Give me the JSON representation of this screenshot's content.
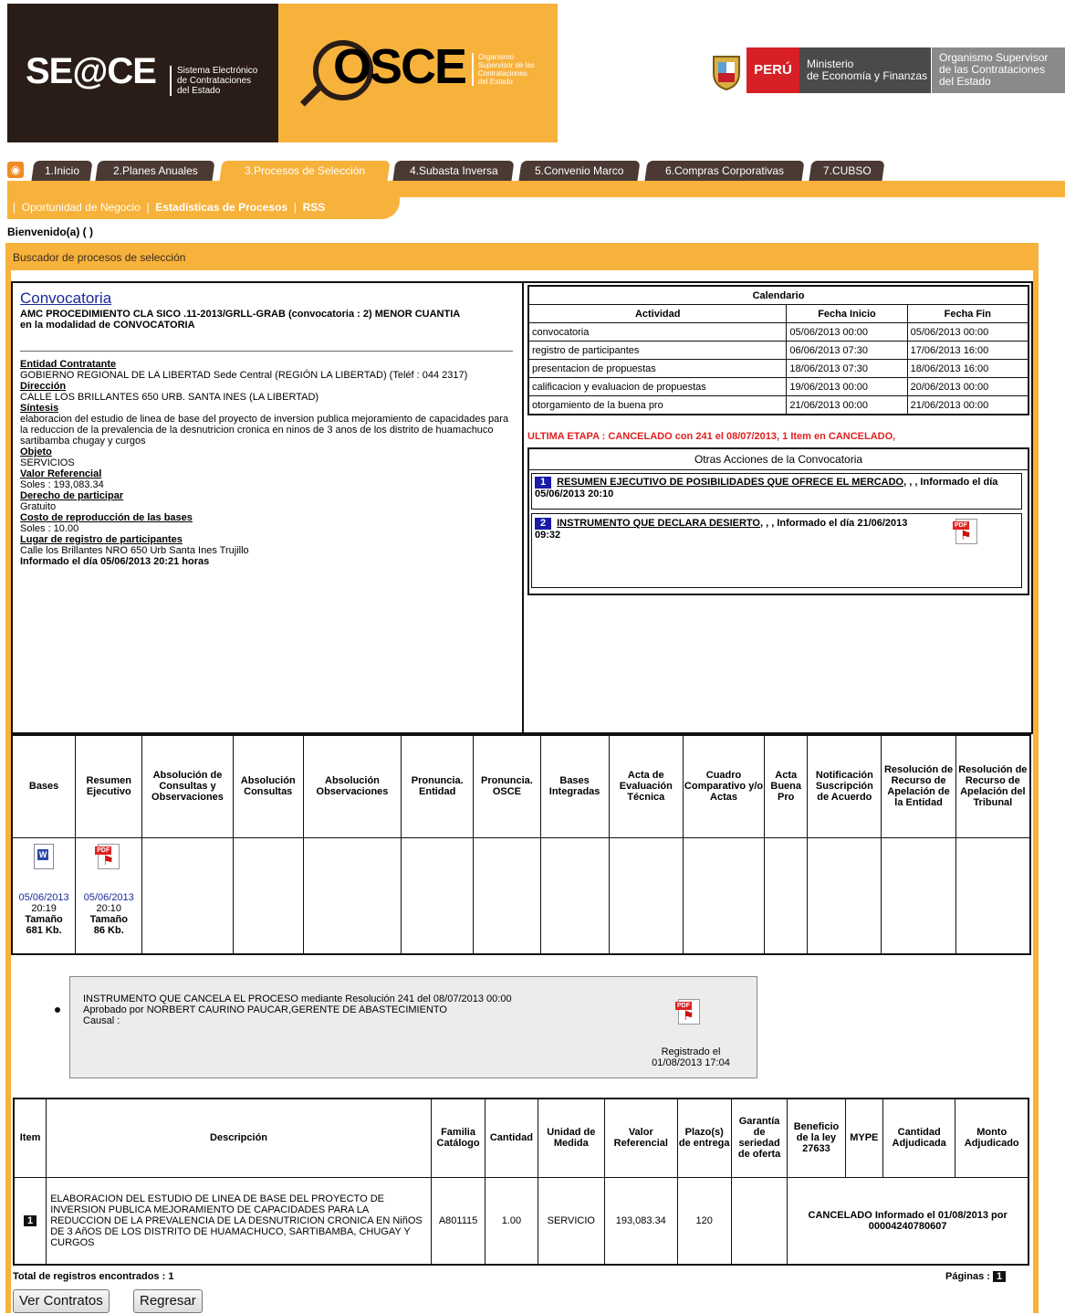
{
  "header": {
    "seace_logo": "SE@CE",
    "seace_sub": [
      "Sistema Electrónico",
      "de Contrataciones",
      "del Estado"
    ],
    "osce_logo": "OSCE",
    "osce_sub": [
      "Organismo",
      "Supervisor de las",
      "Contrataciones",
      "del Estado"
    ],
    "peru_label": "PERÚ",
    "ministerio": [
      "Ministerio",
      "de Economía y Finanzas"
    ],
    "osce_full": [
      "Organismo Supervisor",
      "de las Contrataciones",
      "del Estado"
    ]
  },
  "tabs": [
    {
      "label": "1.Inicio"
    },
    {
      "label": "2.Planes Anuales"
    },
    {
      "label": "3.Procesos de Selección"
    },
    {
      "label": "4.Subasta Inversa"
    },
    {
      "label": "5.Convenio Marco"
    },
    {
      "label": "6.Compras Corporativas"
    },
    {
      "label": "7.CUBSO"
    }
  ],
  "subnav": {
    "item1": "Oportunidad de Negocio",
    "item2": "Estadísticas de Procesos",
    "item3": "RSS",
    "sep": "|"
  },
  "welcome": "Bienvenido(a) ( )",
  "panel_title": "Buscador de procesos de selección",
  "convocatoria": {
    "title": "Convocatoria",
    "line1": "AMC PROCEDIMIENTO CLA SICO .11-2013/GRLL-GRAB (convocatoria : 2) MENOR CUANTIA",
    "line2": "en la modalidad de CONVOCATORIA",
    "entidad_label": "Entidad Contratante",
    "entidad": "GOBIERNO REGIONAL DE LA LIBERTAD Sede Central (REGIÓN LA LIBERTAD) (Teléf : 044 2317)",
    "direccion_label": "Dirección",
    "direccion": "CALLE LOS BRILLANTES 650 URB. SANTA INES (LA LIBERTAD)",
    "sintesis_label": "Síntesis",
    "sintesis": "elaboracion del estudio de linea de base del proyecto de inversion publica mejoramiento de capacidades para la reduccion de la prevalencia de la desnutricion cronica en ninos de 3 anos de los distrito de huamachuco sartibamba chugay y curgos",
    "objeto_label": "Objeto",
    "objeto": "SERVICIOS",
    "valor_label": "Valor Referencial",
    "valor": "Soles : 193,083.34",
    "derecho_label": "Derecho de participar",
    "derecho": "Gratuito",
    "costo_label": "Costo de reproducción de las bases",
    "costo": "Soles : 10.00",
    "lugar_label": "Lugar de registro de participantes",
    "lugar": "Calle los Brillantes NRO 650 Urb Santa Ines Trujillo",
    "informado": "Informado el día 05/06/2013 20:21 horas"
  },
  "calendario": {
    "title": "Calendario",
    "headers": [
      "Actividad",
      "Fecha Inicio",
      "Fecha Fin"
    ],
    "rows": [
      [
        "convocatoria",
        "05/06/2013 00:00",
        "05/06/2013 00:00"
      ],
      [
        "registro de participantes",
        "06/06/2013 07:30",
        "17/06/2013 16:00"
      ],
      [
        "presentacion de propuestas",
        "18/06/2013 07:30",
        "18/06/2013 16:00"
      ],
      [
        "calificacion y evaluacion de propuestas",
        "19/06/2013 00:00",
        "20/06/2013 00:00"
      ],
      [
        "otorgamiento de la buena pro",
        "21/06/2013 00:00",
        "21/06/2013 00:00"
      ]
    ],
    "ultima_etapa": "ULTIMA ETAPA : CANCELADO con 241 el 08/07/2013, 1 Item en CANCELADO,"
  },
  "otras": {
    "title": "Otras Acciones de la Convocatoria",
    "items": [
      {
        "num": "1",
        "title": "RESUMEN EJECUTIVO DE POSIBILIDADES QUE OFRECE EL MERCADO",
        "rest": ", , , Informado el día 05/06/2013 20:10"
      },
      {
        "num": "2",
        "title": "INSTRUMENTO QUE DECLARA DESIERTO",
        "rest": ", , , Informado el día 21/06/2013 09:32"
      }
    ]
  },
  "docs_table": {
    "headers": [
      "Bases",
      "Resumen Ejecutivo",
      "Absolución de Consultas y Observaciones",
      "Absolución Consultas",
      "Absolución Observaciones",
      "Pronuncia. Entidad",
      "Pronuncia. OSCE",
      "Bases Integradas",
      "Acta de Evaluación Técnica",
      "Cuadro Comparativo y/o Actas",
      "Acta Buena Pro",
      "Notificación Suscripción de Acuerdo",
      "Resolución de Recurso de Apelación de la Entidad",
      "Resolución de Recurso de Apelación del Tribunal"
    ],
    "bases": {
      "date": "05/06/2013",
      "time": "20:19",
      "size_label": "Tamaño",
      "size": "681 Kb."
    },
    "resumen": {
      "date": "05/06/2013",
      "time": "20:10",
      "size_label": "Tamaño",
      "size": "86 Kb."
    }
  },
  "cancel_box": {
    "line1": "INSTRUMENTO QUE CANCELA EL PROCESO mediante Resolución 241 del 08/07/2013 00:00",
    "line2": "Aprobado por NORBERT CAURINO PAUCAR,GERENTE DE ABASTECIMIENTO",
    "line3": "Causal :",
    "registrado": "Registrado el",
    "registrado_date": "01/08/2013 17:04"
  },
  "items_table": {
    "headers": [
      "Item",
      "Descripción",
      "Familia Catálogo",
      "Cantidad",
      "Unidad de Medida",
      "Valor Referencial",
      "Plazo(s) de entrega",
      "Garantía de seriedad de oferta",
      "Beneficio de la ley 27633",
      "MYPE",
      "Cantidad Adjudicada",
      "Monto Adjudicado"
    ],
    "row": {
      "item": "1",
      "descripcion": "ELABORACION DEL ESTUDIO DE LINEA DE BASE DEL PROYECTO DE INVERSION PUBLICA MEJORAMIENTO DE CAPACIDADES PARA LA REDUCCION DE LA PREVALENCIA DE LA DESNUTRICION CRONICA EN NiñOS DE 3 AñOS DE LOS DISTRITO DE HUAMACHUCO, SARTIBAMBA, CHUGAY Y CURGOS",
      "familia": "A801115",
      "cantidad": "1.00",
      "unidad": "SERVICIO",
      "valor": "193,083.34",
      "plazo": "120",
      "estado": "CANCELADO Informado el 01/08/2013 por 00004240780607"
    }
  },
  "footer": {
    "total": "Total de registros encontrados : 1",
    "paginas": "Páginas :",
    "page": "1",
    "btn_contratos": "Ver Contratos",
    "btn_regresar": "Regresar"
  },
  "colors": {
    "orange": "#f7b23b",
    "dark": "#2a1d17",
    "red": "#e02020",
    "blue": "#1a1aa8"
  }
}
